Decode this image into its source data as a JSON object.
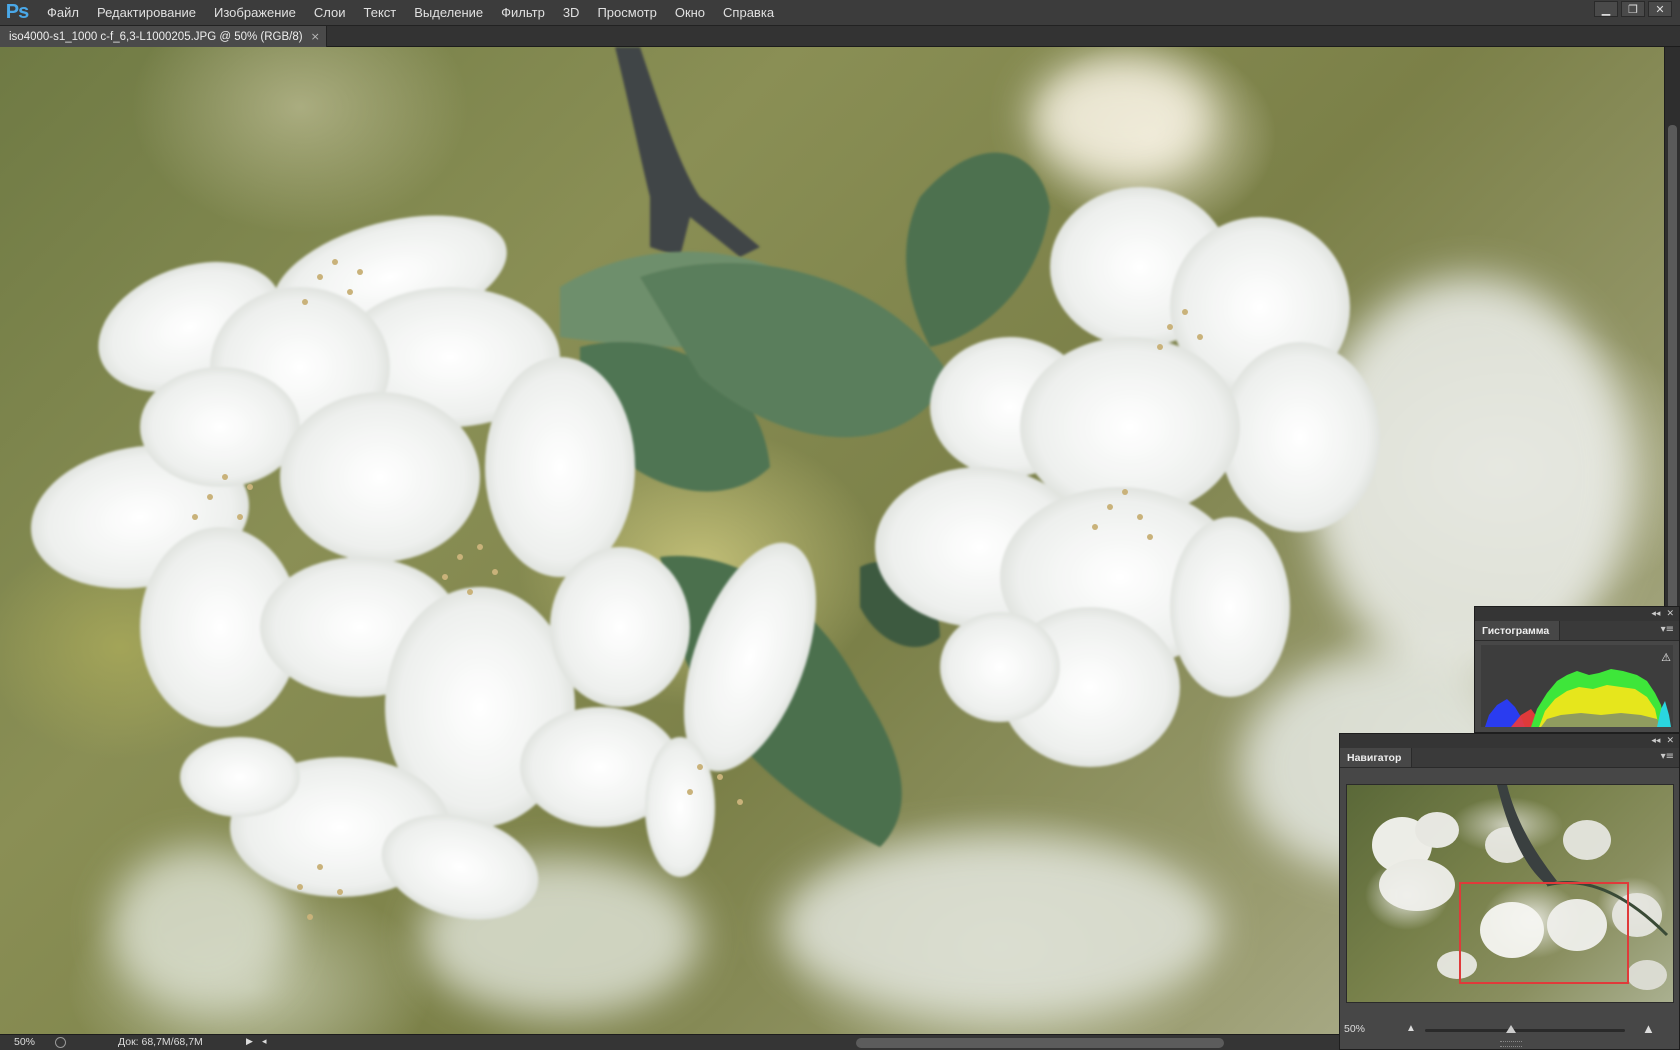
{
  "app": {
    "logo": "Ps",
    "menu": [
      "Файл",
      "Редактирование",
      "Изображение",
      "Слои",
      "Текст",
      "Выделение",
      "Фильтр",
      "3D",
      "Просмотр",
      "Окно",
      "Справка"
    ],
    "window_controls": {
      "minimize": "▁",
      "restore": "❐",
      "close": "✕"
    }
  },
  "document": {
    "tab_title": "iso4000-s1_1000 c-f_6,3-L1000205.JPG @ 50% (RGB/8)",
    "tab_close": "×"
  },
  "status": {
    "zoom": "50%",
    "doc_info": "Док: 68,7M/68,7M",
    "arrow_right": "▶",
    "arrow_left": "◂"
  },
  "panels": {
    "histogram": {
      "tab_label": "Гистограмма",
      "warning": "⚠",
      "collapse": "◂◂",
      "close": "✕",
      "menu": "▾≡"
    },
    "navigator": {
      "tab_label": "Навигатор",
      "zoom": "50%",
      "zoom_out": "▲",
      "zoom_in": "▲",
      "collapse": "◂◂",
      "close": "✕",
      "menu": "▾≡",
      "zoom_slider_fraction": 0.43
    }
  },
  "colors": {
    "accent": "#4aa8e8",
    "navigator_view_box": "#e03a3a",
    "histogram_blue": "#2a3cf0",
    "histogram_green": "#3ee63a",
    "histogram_yellow": "#e6e61c",
    "histogram_red": "#f03a3a"
  }
}
